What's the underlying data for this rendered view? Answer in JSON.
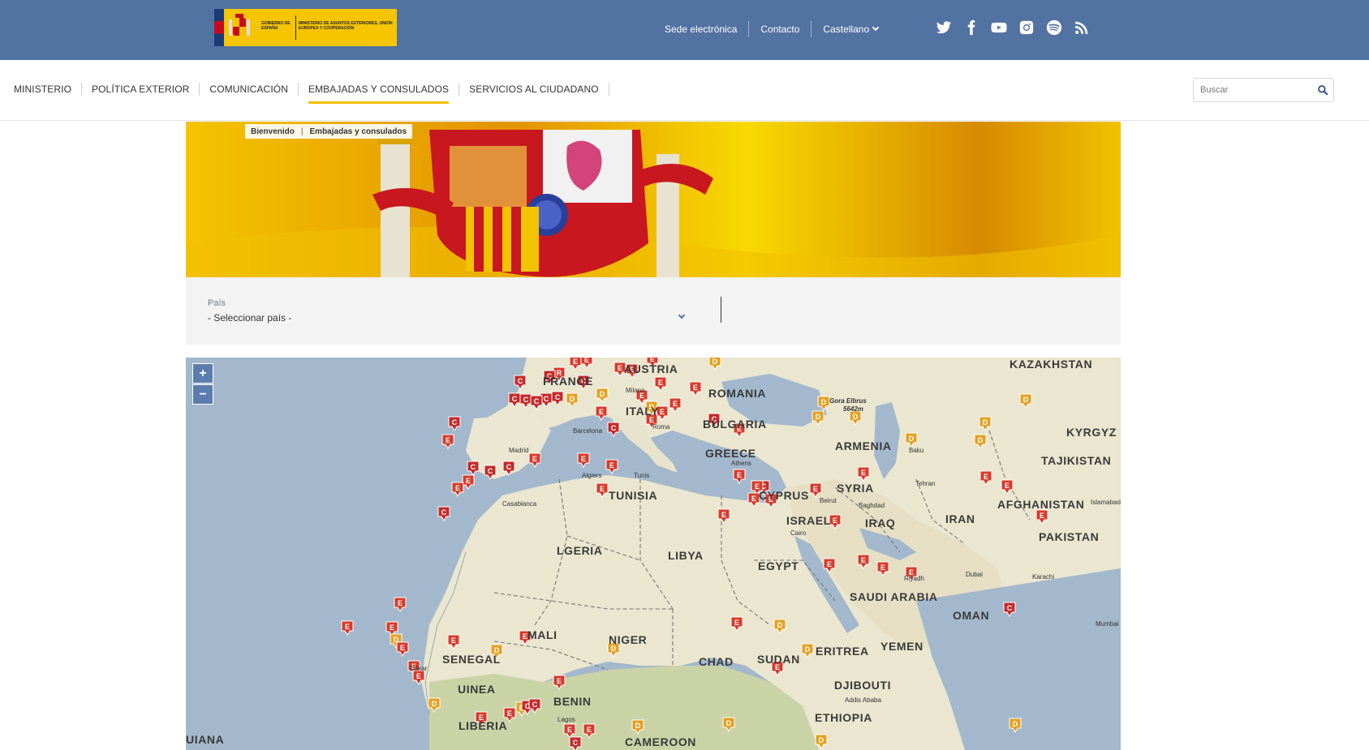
{
  "header": {
    "logo_line1": "Gobierno de España",
    "logo_line2": "Ministerio de Asuntos Exteriores, Unión Europea y Cooperación",
    "links": [
      "Sede electrónica",
      "Contacto",
      "Castellano"
    ],
    "social": [
      "twitter-icon",
      "facebook-icon",
      "youtube-icon",
      "instagram-icon",
      "spotify-icon",
      "rss-icon"
    ]
  },
  "nav": {
    "items": [
      "MINISTERIO",
      "POLÍTICA EXTERIOR",
      "COMUNICACIÓN",
      "EMBAJADAS Y CONSULADOS",
      "SERVICIOS AL CIUDADANO"
    ],
    "active": "EMBAJADAS Y CONSULADOS",
    "search_placeholder": "Buscar"
  },
  "breadcrumb": [
    "Bienvenido",
    "Embajadas y consulados"
  ],
  "filter": {
    "label": "País",
    "selected": "- Seleccionar país -"
  },
  "map": {
    "zoom_in": "+",
    "zoom_out": "−",
    "countries": [
      "KAZAKHSTAN",
      "FRANCE",
      "AUSTRIA",
      "ROMANIA",
      "ITALY",
      "BULGARIA",
      "KYRGYZ",
      "ARMENIA",
      "TAJIKISTAN",
      "GREECE",
      "SYRIA",
      "CYPRUS",
      "TUNISIA",
      "AFGHANISTAN",
      "IRAN",
      "IRAQ",
      "ISRAEL",
      "PAKISTAN",
      "LGERIA",
      "LIBYA",
      "EGYPT",
      "SAUDI ARABIA",
      "OMAN",
      "MALI",
      "NIGER",
      "CHAD",
      "SUDAN",
      "ERITREA",
      "YEMEN",
      "SENEGAL",
      "DJIBOUTI",
      "UINEA",
      "BENIN",
      "ETHIOPIA",
      "LIBERIA",
      "CAMEROON",
      "UIANA"
    ],
    "cities": [
      "Gora Elbrus",
      "5642m",
      "Milano",
      "Barcelona",
      "Madrid",
      "Roma",
      "Athens",
      "Baku",
      "Tehran",
      "Algiers",
      "Tunis",
      "Beirut",
      "Baghdad",
      "Islamabad",
      "Casablanca",
      "Cairo",
      "Riyadh",
      "Dubai",
      "Karachi",
      "Mumbai",
      "Dakar",
      "Addis Ababa",
      "Lagos"
    ],
    "colors": {
      "embassy": "#d93a2b",
      "consulate": "#c62a2a",
      "office": "#e5a020"
    }
  }
}
